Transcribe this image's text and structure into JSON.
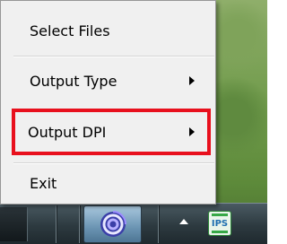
{
  "context_menu": {
    "items": [
      {
        "label": "Select Files",
        "has_submenu": false
      },
      {
        "label": "Output Type",
        "has_submenu": true
      },
      {
        "label": "Output DPI",
        "has_submenu": true,
        "highlighted": true
      },
      {
        "label": "Exit",
        "has_submenu": false
      }
    ],
    "highlight_color": "#e8101d"
  },
  "taskbar": {
    "tray_icon_label": "IPS",
    "app_icon": "swirl-app-icon",
    "overflow_icon": "show-hidden-icons-arrow"
  }
}
